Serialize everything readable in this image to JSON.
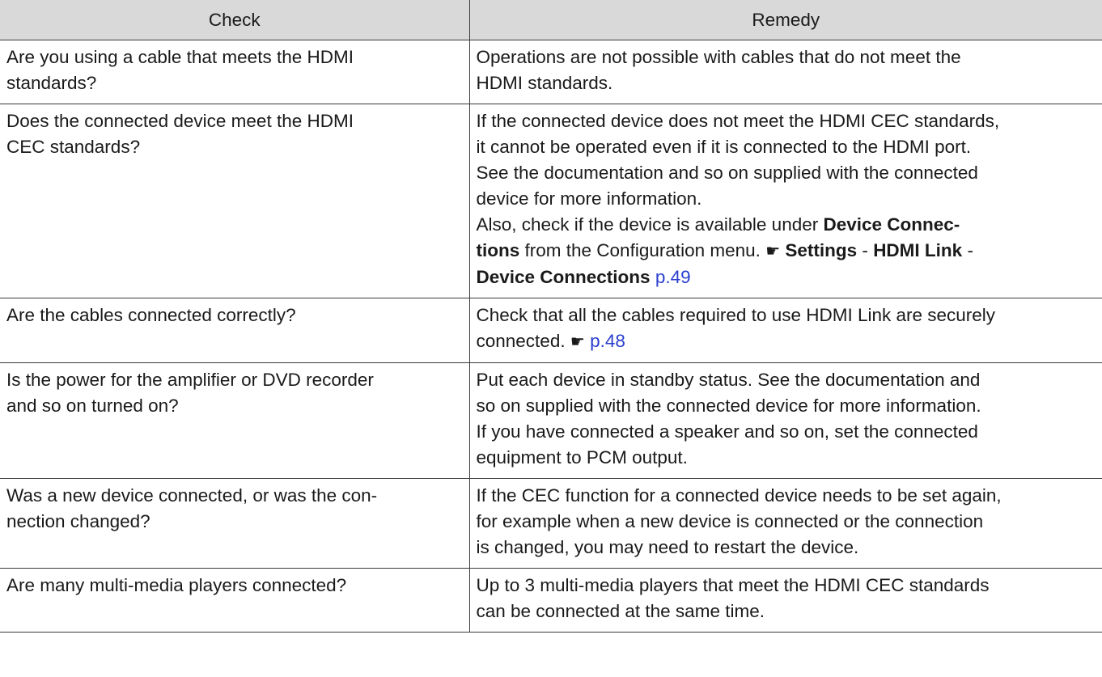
{
  "header": {
    "check": "Check",
    "remedy": "Remedy"
  },
  "rows": [
    {
      "check": [
        "Are you using a cable that meets the HDMI",
        "standards?"
      ],
      "remedy": [
        "Operations are not possible with cables that do not meet the",
        "HDMI standards."
      ]
    },
    {
      "check": [
        "Does the connected device meet the HDMI",
        "CEC standards?"
      ],
      "remedy": [
        "If the connected device does not meet the HDMI CEC standards,",
        "it cannot be operated even if it is connected to the HDMI port.",
        "See the documentation and so on supplied with the connected",
        "device for more information.",
        "Also, check if the device is available under"
      ],
      "remedy_bold_1": "Device Connec-",
      "remedy_bold_2": "tions",
      "remedy_text_after_bold": "from the Configuration menu.",
      "ref_icon": "☛",
      "ref_settings": "Settings",
      "ref_sep_1": "-",
      "ref_hdmi_link": "HDMI Link",
      "ref_sep_2": "-",
      "ref_device_connections": "Device Connections",
      "ref_page": "p.49"
    },
    {
      "check": [
        "Are the cables connected correctly?"
      ],
      "remedy": [
        "Check that all the cables required to use HDMI Link are securely",
        "connected."
      ],
      "ref_icon": "☛",
      "ref_page": "p.48"
    },
    {
      "check": [
        "Is the power for the amplifier or DVD recorder",
        "and so on turned on?"
      ],
      "remedy": [
        "Put each device in standby status. See the documentation and",
        "so on supplied with the connected device for more information.",
        "If you have connected a speaker and so on, set the connected",
        "equipment to PCM output."
      ]
    },
    {
      "check": [
        "Was a new device connected, or was the con-",
        "nection changed?"
      ],
      "remedy": [
        "If the CEC function for a connected device needs to be set again,",
        "for example when a new device is connected or the connection",
        "is changed, you may need to restart the device."
      ]
    },
    {
      "check": [
        "Are many multi-media players connected?"
      ],
      "remedy": [
        "Up to 3 multi-media players that meet the HDMI CEC standards",
        "can be connected at the same time."
      ]
    }
  ],
  "colors": {
    "header_bg": "#d9d9d9",
    "link": "#2a3fd0",
    "border": "#3a3a3a"
  }
}
